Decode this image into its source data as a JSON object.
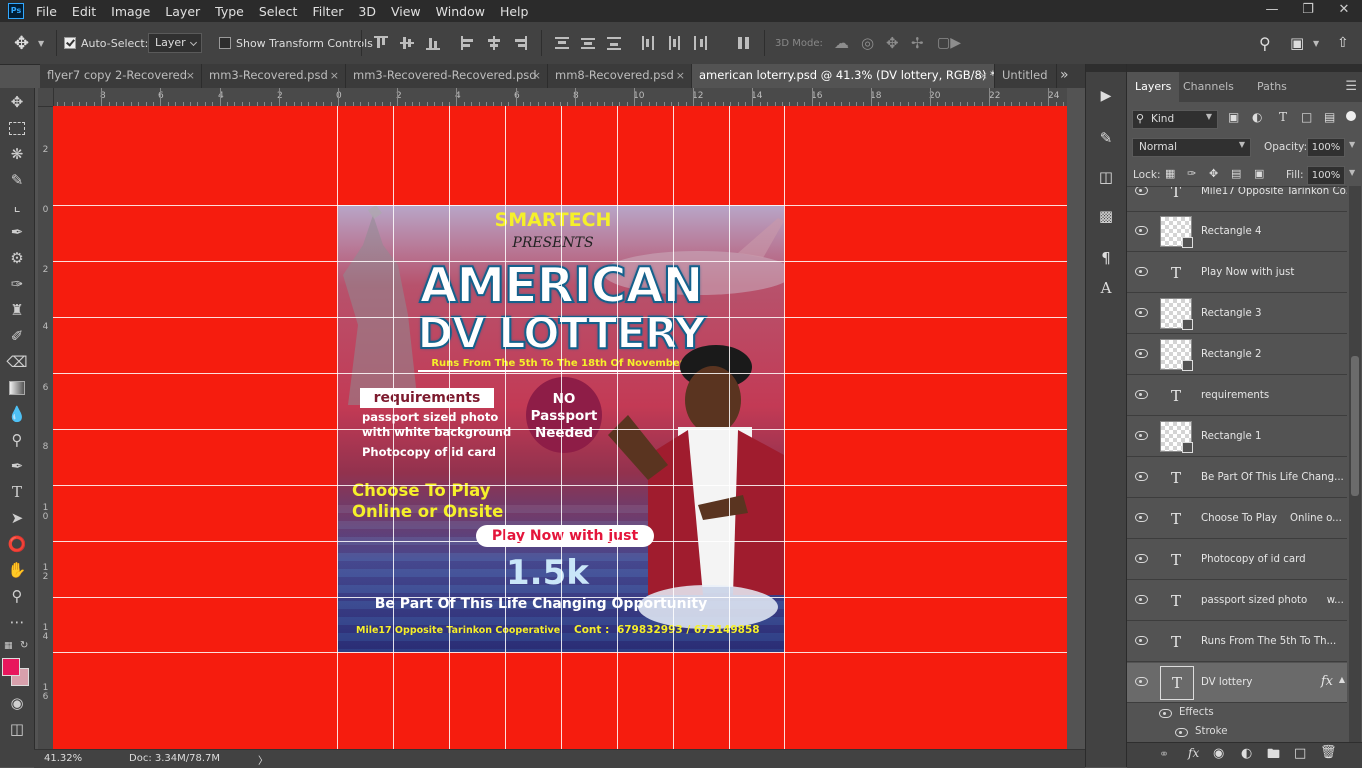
{
  "menu": [
    "File",
    "Edit",
    "Image",
    "Layer",
    "Type",
    "Select",
    "Filter",
    "3D",
    "View",
    "Window",
    "Help"
  ],
  "app_logo": "Ps",
  "options": {
    "auto_select_label": "Auto-Select:",
    "auto_select_value": "Layer",
    "show_transform_label": "Show Transform Controls",
    "mode_3d_label": "3D Mode:"
  },
  "tabs": [
    {
      "label": "flyer7 copy 2-Recovered",
      "close": "×"
    },
    {
      "label": "mm3-Recovered.psd",
      "close": "×"
    },
    {
      "label": "mm3-Recovered-Recovered.psd",
      "close": "×"
    },
    {
      "label": "mm8-Recovered.psd",
      "close": "×"
    },
    {
      "label": "american loterry.psd @ 41.3% (DV lottery, RGB/8) *",
      "close": "×"
    },
    {
      "label": "Untitled",
      "close": ""
    }
  ],
  "tab_overflow": "»",
  "ruler_top": [
    "8",
    "6",
    "4",
    "2",
    "0",
    "2",
    "4",
    "6",
    "8",
    "10",
    "12",
    "14",
    "16",
    "18",
    "20",
    "22",
    "24"
  ],
  "ruler_left": [
    "2",
    "0",
    "2",
    "4",
    "6",
    "8",
    "1\n0",
    "1\n2",
    "1\n4",
    "1\n6"
  ],
  "poster": {
    "brand": "SMARTECH",
    "presents": "PRESENTS",
    "title1": "AMERICAN",
    "title2": "DV LOTTERY",
    "runs": "Runs From The 5th To The 18th Of November",
    "req_heading": "requirements",
    "req1": "passport sized photo",
    "req2": "with white background",
    "req3": "Photocopy of id card",
    "no_passport": [
      "NO",
      "Passport",
      "Needed"
    ],
    "choose1": "Choose To Play",
    "choose2": "Online or Onsite",
    "play_now": "Play Now with just",
    "price": "1.5k",
    "tagline": "Be Part Of This Life Changing Opportunity",
    "address": "Mile17 Opposite Tarinkon Cooperative",
    "contact_label": "Cont :",
    "contact_numbers": "679832993 / 673149858"
  },
  "status": {
    "zoom": "41.32%",
    "doc": "Doc: 3.34M/78.7M",
    "arrow": "〉"
  },
  "panel": {
    "tabs": [
      "Layers",
      "Channels",
      "Paths"
    ],
    "filter_label": "Kind",
    "blend_mode": "Normal",
    "opacity_label": "Opacity:",
    "opacity_value": "100%",
    "lock_label": "Lock:",
    "fill_label": "Fill:",
    "fill_value": "100%",
    "layers": [
      {
        "name": "Mile17 Opposite Tarinkon Co...",
        "kind": "text"
      },
      {
        "name": "Rectangle 4",
        "kind": "shape"
      },
      {
        "name": "Play Now with just",
        "kind": "text"
      },
      {
        "name": "Rectangle 3",
        "kind": "shape"
      },
      {
        "name": "Rectangle 2",
        "kind": "shape"
      },
      {
        "name": "requirements",
        "kind": "text"
      },
      {
        "name": "Rectangle 1",
        "kind": "shape"
      },
      {
        "name": "Be Part Of This Life Chang...",
        "kind": "text"
      },
      {
        "name": "Choose To Play    Online o...",
        "kind": "text"
      },
      {
        "name": "Photocopy of id card",
        "kind": "text"
      },
      {
        "name": "passport sized photo      w...",
        "kind": "text"
      },
      {
        "name": "Runs From The 5th To Th...",
        "kind": "text"
      },
      {
        "name": "DV lottery",
        "kind": "text",
        "selected": true,
        "fx": "fx"
      }
    ],
    "effects_label": "Effects",
    "stroke_label": "Stroke"
  },
  "colors": {
    "canvas_bg": "#f61c0e",
    "foreground": "#e8175d",
    "background": "#d8a0ac",
    "accent_yellow": "#f5f02a"
  }
}
